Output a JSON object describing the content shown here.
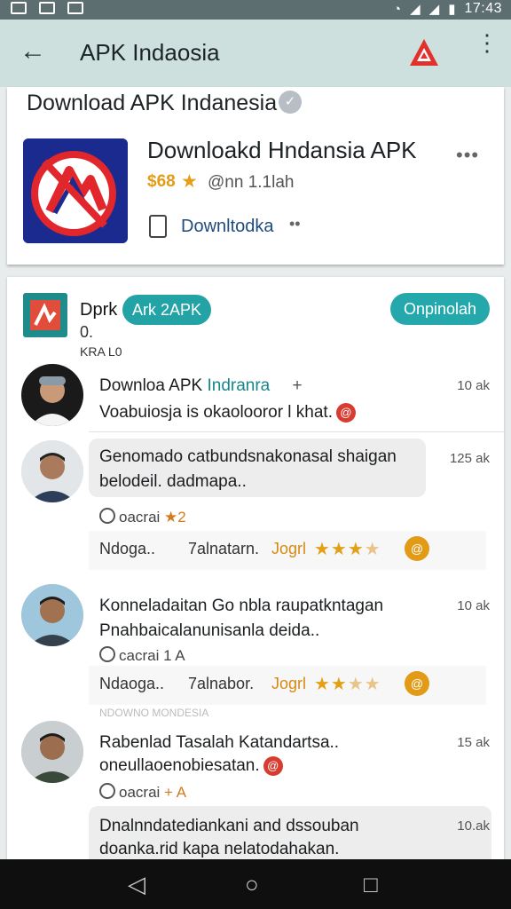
{
  "status_bar": {
    "time": "17:43"
  },
  "app_bar": {
    "back_icon": "arrow-left-icon",
    "title": "APK Indaosia",
    "logo_icon": "apk-logo-icon",
    "more_icon": "more-vert-icon"
  },
  "header_card": {
    "heading": "Download APK Indanesia",
    "app_title": "Downloakd Hndansia APK",
    "price": "$68",
    "downloads": "@nn 1.1lah",
    "download_label": "Downltodka",
    "dots": "••"
  },
  "app_row": {
    "name": "Dprk",
    "pill": "Ark 2APK",
    "open_button": "Onpinolah",
    "sub1": "0.",
    "sub2": "KRA L0"
  },
  "reviews": [
    {
      "name": "Downloa APK",
      "name_hl": "Indranra",
      "extra": "+",
      "time": "10 ak",
      "body": "Voabuiosja is okaolooror l khat.",
      "badge": "@"
    },
    {
      "time": "125 ak",
      "body1": "Genomado catbundsnakonasal shaigan",
      "body2": "belodeil. dadmapa..",
      "tag": "oacrai",
      "tag_hl": "★2",
      "bar_a": "Ndoga..",
      "bar_b": "7alnatarn.",
      "bar_c": "Jogrl",
      "badge": "@"
    },
    {
      "time": "10 ak",
      "body1": "Konneladaitan Go nbla raupatkntagan",
      "body2": "Pnahbaicalanunisanla deida..",
      "tag": "cacrai 1 A",
      "bar_a": "Ndaoga..",
      "bar_b": "7alnabor.",
      "bar_c": "Jogrl",
      "badge": "@"
    },
    {
      "time": "15 ak",
      "body1": "Rabenlad Tasalah Katandartsa..",
      "body2": "oneullaoenobiesatan.",
      "tag": "oacrai",
      "tag_hl": "+ A",
      "badge": "@"
    },
    {
      "time": "10.ak",
      "body1": "Dnalnndatediankani and dssouban",
      "body2": "doanka.rid kapa nelatodahakan."
    }
  ],
  "faded_caption": "NDOWNO MONDESIA",
  "nav": {
    "back": "◁",
    "home": "○",
    "recents": "□"
  }
}
